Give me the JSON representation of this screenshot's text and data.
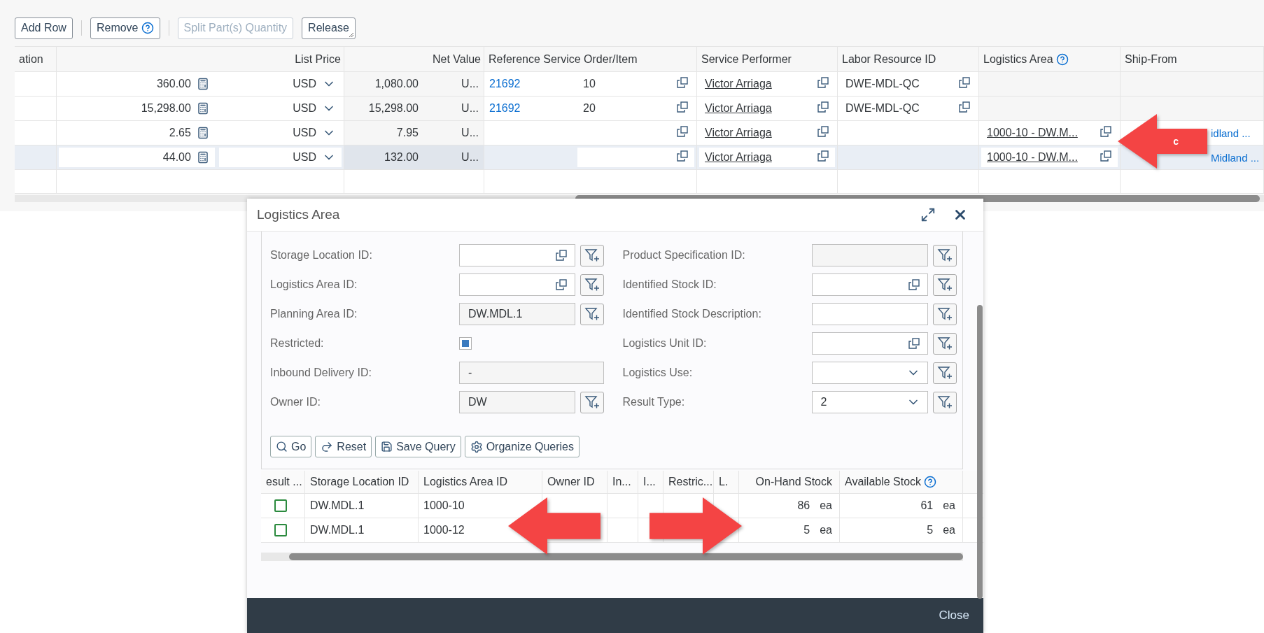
{
  "toolbar": {
    "buttons": [
      {
        "label": "Add Row",
        "disabled": false,
        "kind": "plain"
      },
      {
        "label": "Remove",
        "disabled": false,
        "kind": "help"
      },
      {
        "label": "Split Part(s) Quantity",
        "disabled": true,
        "kind": "plain"
      },
      {
        "label": "Release",
        "disabled": false,
        "kind": "menu"
      }
    ]
  },
  "table": {
    "columns": [
      {
        "label": "ation"
      },
      {
        "label": "List Price"
      },
      {
        "label": "Net Value"
      },
      {
        "label": "Reference Service Order/Item"
      },
      {
        "label": "Service Performer"
      },
      {
        "label": "Labor Resource ID"
      },
      {
        "label": "Logistics Area",
        "help": true
      },
      {
        "label": "Ship-From"
      }
    ],
    "rows": [
      {
        "selected": false,
        "list_price": "360.00",
        "currency": "USD",
        "net_value": "1,080.00",
        "net_unit": "U...",
        "order": "21692",
        "item": "10",
        "performer": "Victor Arriaga",
        "labor_resource": "DWE-MDL-QC"
      },
      {
        "selected": false,
        "list_price": "15,298.00",
        "currency": "USD",
        "net_value": "15,298.00",
        "net_unit": "U...",
        "order": "21692",
        "item": "20",
        "performer": "Victor Arriaga",
        "labor_resource": "DWE-MDL-QC"
      },
      {
        "selected": false,
        "list_price": "2.65",
        "currency": "USD",
        "net_value": "7.95",
        "net_unit": "U...",
        "performer": "Victor Arriaga",
        "logistics_area": "1000-10 - DW.M...",
        "ship_from": "idland ..."
      },
      {
        "selected": true,
        "list_price": "44.00",
        "currency": "USD",
        "net_value": "132.00",
        "net_unit": "U...",
        "performer": "Victor Arriaga",
        "logistics_area": "1000-10 - DW.M...",
        "ship_from": "Midland ..."
      }
    ]
  },
  "dialog": {
    "title": "Logistics Area",
    "filters_left": [
      {
        "label": "Storage Location ID:",
        "kind": "input",
        "value_help": true,
        "filter": true
      },
      {
        "label": "Logistics Area ID:",
        "kind": "input",
        "value_help": true,
        "filter": true
      },
      {
        "label": "Planning Area ID:",
        "kind": "readonly",
        "value": "DW.MDL.1",
        "filter": true
      },
      {
        "label": "Restricted:",
        "kind": "checkbox",
        "checked": true
      },
      {
        "label": "Inbound Delivery ID:",
        "kind": "readonly",
        "value": "-"
      },
      {
        "label": "Owner ID:",
        "kind": "readonly",
        "value": "DW",
        "filter": true
      }
    ],
    "filters_right": [
      {
        "label": "Product Specification ID:",
        "kind": "readonly",
        "filter": true
      },
      {
        "label": "Identified Stock ID:",
        "kind": "input",
        "value_help": true,
        "filter": true
      },
      {
        "label": "Identified Stock Description:",
        "kind": "input",
        "filter": true
      },
      {
        "label": "Logistics Unit ID:",
        "kind": "input",
        "value_help": true,
        "filter": true
      },
      {
        "label": "Logistics Use:",
        "kind": "select",
        "filter": true
      },
      {
        "label": "Result Type:",
        "kind": "select",
        "value": "2",
        "filter": true
      }
    ],
    "actions": [
      {
        "label": "Go",
        "kind": "go"
      },
      {
        "label": "Reset",
        "kind": "reset"
      },
      {
        "label": "Save Query",
        "kind": "save"
      },
      {
        "label": "Organize Queries",
        "kind": "organize"
      }
    ],
    "results": {
      "columns": [
        {
          "label": "esult ..."
        },
        {
          "label": "Storage Location ID"
        },
        {
          "label": "Logistics Area ID"
        },
        {
          "label": "Owner ID"
        },
        {
          "label": "In..."
        },
        {
          "label": "I..."
        },
        {
          "label": "Restric..."
        },
        {
          "label": "L."
        },
        {
          "label": "On-Hand Stock"
        },
        {
          "label": "Available Stock",
          "help": true
        }
      ],
      "rows": [
        {
          "result_checked": false,
          "storage_location": "DW.MDL.1",
          "logistics_area": "1000-10",
          "on_hand": "86",
          "on_hand_unit": "ea",
          "available": "61",
          "available_unit": "ea"
        },
        {
          "result_checked": false,
          "storage_location": "DW.MDL.1",
          "logistics_area": "1000-12",
          "on_hand": "5",
          "on_hand_unit": "ea",
          "available": "5",
          "available_unit": "ea"
        }
      ]
    },
    "footer_button": "Close"
  },
  "annotations": [
    {
      "kind": "left_arrow",
      "label": "c"
    },
    {
      "kind": "left_arrow"
    },
    {
      "kind": "right_arrow"
    }
  ]
}
